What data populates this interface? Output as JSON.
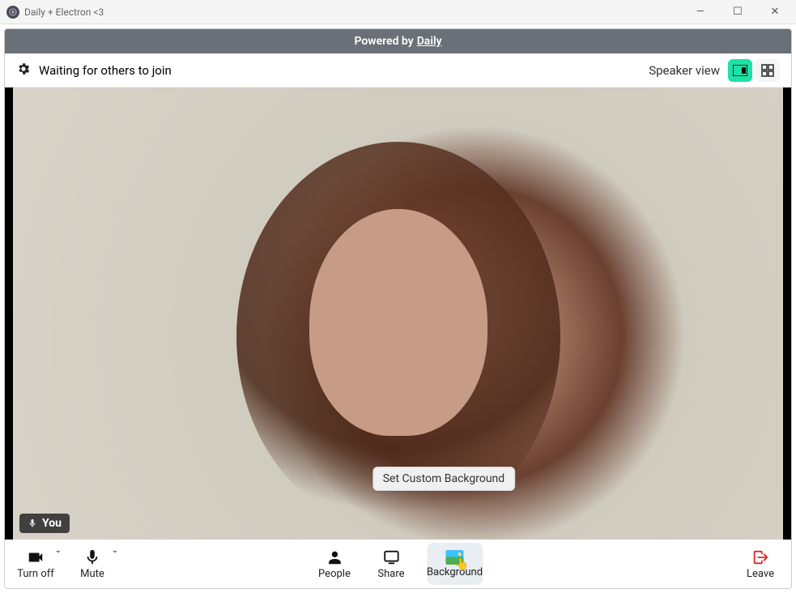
{
  "window": {
    "title": "Daily + Electron <3"
  },
  "banner": {
    "prefix": "Powered by",
    "link": "Daily"
  },
  "status": {
    "waiting": "Waiting for others to join",
    "view_label": "Speaker view"
  },
  "video": {
    "you_label": "You"
  },
  "tooltip": {
    "background": "Set Custom Background"
  },
  "controls": {
    "turnoff": "Turn off",
    "mute": "Mute",
    "people": "People",
    "share": "Share",
    "background": "Background",
    "leave": "Leave"
  }
}
